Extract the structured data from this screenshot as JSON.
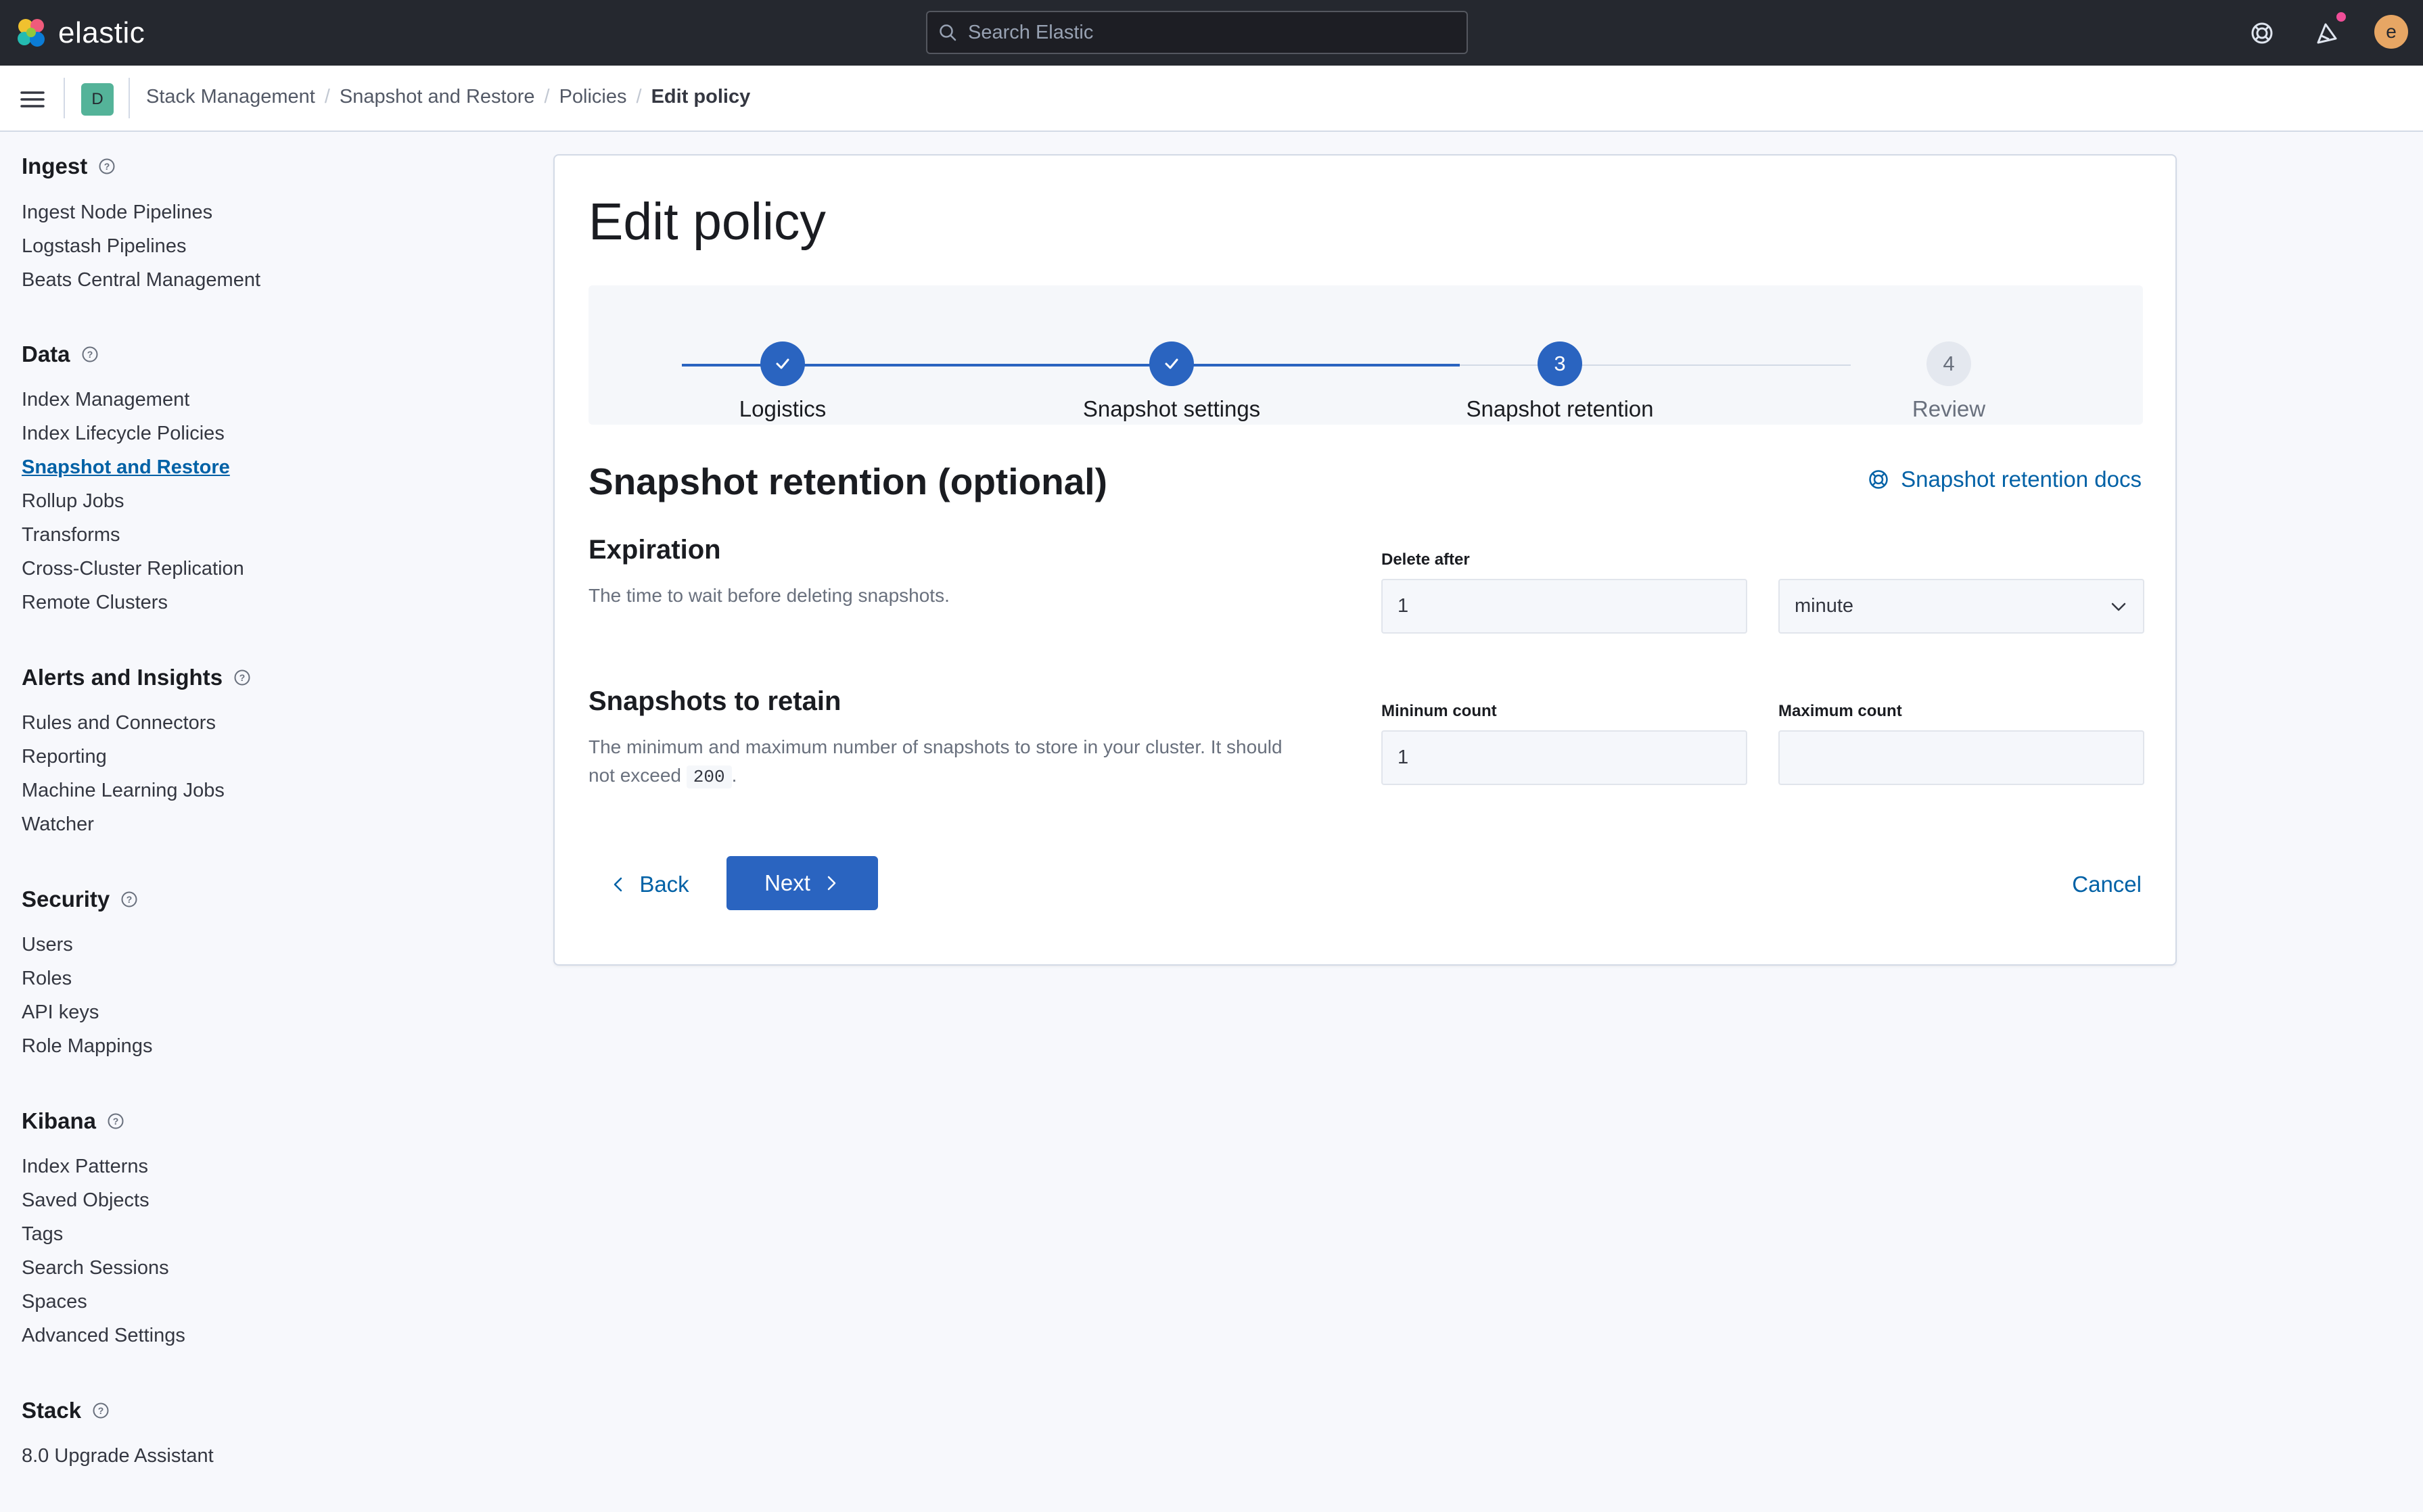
{
  "header": {
    "brand": "elastic",
    "search_placeholder": "Search Elastic",
    "avatar_initial": "e",
    "icons": [
      "elastic-logo-icon",
      "search-icon",
      "help-icon",
      "newsfeed-icon"
    ]
  },
  "breadcrumb_bar": {
    "space_initial": "D",
    "crumbs": [
      "Stack Management",
      "Snapshot and Restore",
      "Policies",
      "Edit policy"
    ]
  },
  "sidebar": {
    "groups": [
      {
        "title": "Ingest",
        "items": [
          "Ingest Node Pipelines",
          "Logstash Pipelines",
          "Beats Central Management"
        ]
      },
      {
        "title": "Data",
        "items": [
          "Index Management",
          "Index Lifecycle Policies",
          "Snapshot and Restore",
          "Rollup Jobs",
          "Transforms",
          "Cross-Cluster Replication",
          "Remote Clusters"
        ]
      },
      {
        "title": "Alerts and Insights",
        "items": [
          "Rules and Connectors",
          "Reporting",
          "Machine Learning Jobs",
          "Watcher"
        ]
      },
      {
        "title": "Security",
        "items": [
          "Users",
          "Roles",
          "API keys",
          "Role Mappings"
        ]
      },
      {
        "title": "Kibana",
        "items": [
          "Index Patterns",
          "Saved Objects",
          "Tags",
          "Search Sessions",
          "Spaces",
          "Advanced Settings"
        ]
      },
      {
        "title": "Stack",
        "items": [
          "8.0 Upgrade Assistant"
        ]
      }
    ],
    "active_item": "Snapshot and Restore"
  },
  "main": {
    "title": "Edit policy",
    "steps": [
      {
        "number": "1",
        "label": "Logistics",
        "status": "complete"
      },
      {
        "number": "2",
        "label": "Snapshot settings",
        "status": "complete"
      },
      {
        "number": "3",
        "label": "Snapshot retention",
        "status": "current"
      },
      {
        "number": "4",
        "label": "Review",
        "status": "incomplete"
      }
    ],
    "section_title": "Snapshot retention (optional)",
    "docs_link": "Snapshot retention docs",
    "expiration": {
      "title": "Expiration",
      "description": "The time to wait before deleting snapshots.",
      "delete_after_label": "Delete after",
      "delete_after_value": "1",
      "unit_value": "minute"
    },
    "retain": {
      "title": "Snapshots to retain",
      "description_line1": "The minimum and maximum number of snapshots to store in your cluster. It should",
      "description_prefix": "not exceed",
      "description_limit": "200",
      "description_suffix": ".",
      "min_label": "Mininum count",
      "min_value": "1",
      "max_label": "Maximum count",
      "max_value": ""
    },
    "buttons": {
      "back": "Back",
      "next": "Next",
      "cancel": "Cancel"
    }
  },
  "colors": {
    "header_bg": "#25282f",
    "primary": "#2a64c0",
    "link": "#0061a6",
    "space_badge": "#54b399",
    "avatar": "#e7a664",
    "notification_dot": "#f04e98"
  }
}
